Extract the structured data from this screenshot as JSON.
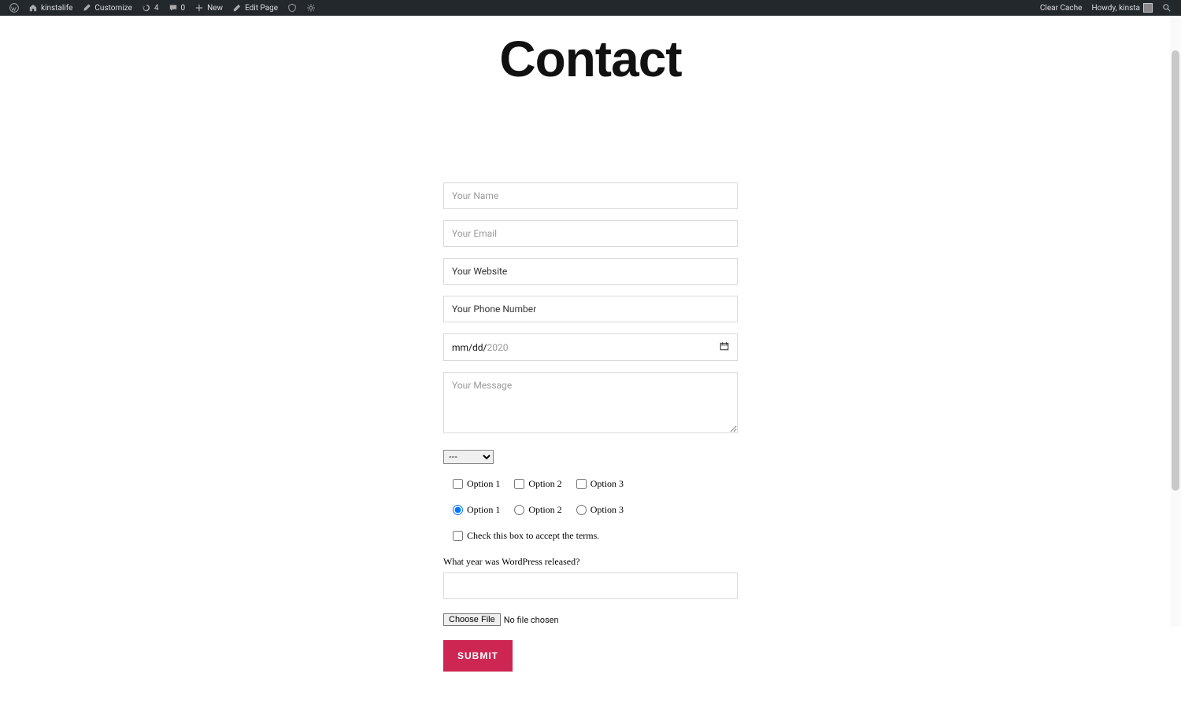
{
  "adminbar": {
    "site_name": "kinstalife",
    "customize": "Customize",
    "updates_count": "4",
    "comments_count": "0",
    "new_label": "New",
    "edit_page": "Edit Page",
    "clear_cache": "Clear Cache",
    "howdy": "Howdy, kinsta"
  },
  "page": {
    "title": "Contact"
  },
  "form": {
    "name_placeholder": "Your Name",
    "email_placeholder": "Your Email",
    "website_label": "Your Website",
    "phone_label": "Your Phone Number",
    "date_mm": "mm",
    "date_dd": "dd",
    "date_yyyy": "2020",
    "message_placeholder": "Your Message",
    "select_default": "---",
    "checkbox_options": [
      "Option 1",
      "Option 2",
      "Option 3"
    ],
    "radio_options": [
      "Option 1",
      "Option 2",
      "Option 3"
    ],
    "radio_selected_index": 0,
    "terms_label": "Check this box to accept the terms.",
    "quiz_question": "What year was WordPress released?",
    "file_button": "Choose File",
    "file_status": "No file chosen",
    "submit_label": "SUBMIT"
  }
}
